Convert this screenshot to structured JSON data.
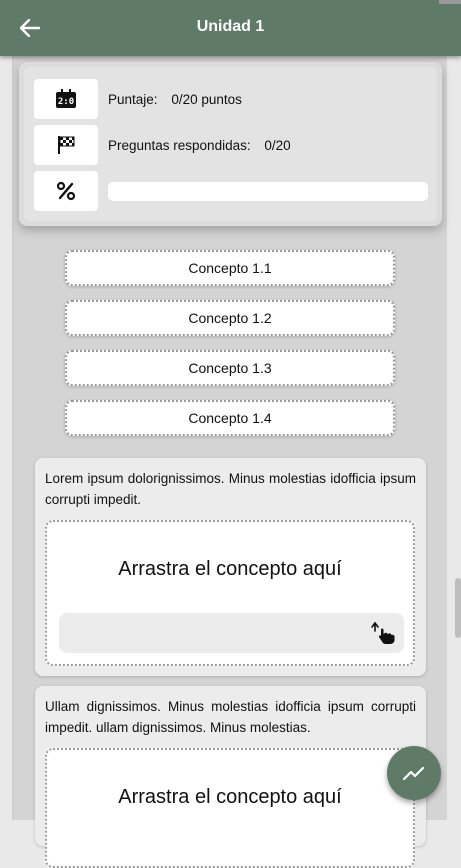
{
  "appbar": {
    "title": "Unidad 1",
    "back_icon": "arrow-left-icon"
  },
  "colors": {
    "primary": "#5f7a66",
    "background": "#d4d4d4",
    "card": "#ececec"
  },
  "stats": {
    "score_label": "Puntaje:",
    "score_value": "0/20 puntos",
    "answered_label": "Preguntas respondidas:",
    "answered_value": "0/20",
    "progress_fraction": 0
  },
  "concepts": [
    "Concepto 1.1",
    "Concepto 1.2",
    "Concepto 1.3",
    "Concepto 1.4"
  ],
  "questions": [
    {
      "text": "Lorem ipsum dolorignissimos. Minus molestias idofficia ipsum corrupti impedit.",
      "drop_label": "Arrastra el concepto aquí"
    },
    {
      "text": "Ullam dignissimos. Minus molestias idofficia ipsum corrupti impedit. ullam dignissimos. Minus molestias.",
      "drop_label": "Arrastra el concepto aquí"
    }
  ]
}
